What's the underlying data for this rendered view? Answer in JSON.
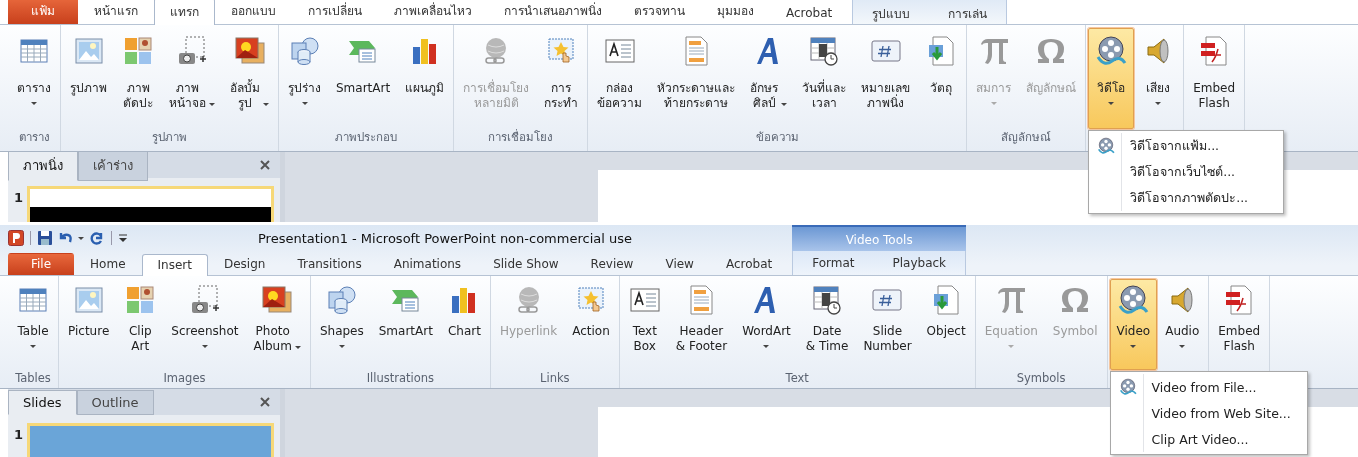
{
  "panels": [
    {
      "tabs": [
        {
          "label": "แฟ้ม",
          "kind": "file",
          "selected": false
        },
        {
          "label": "หน้าแรก",
          "kind": "tab",
          "selected": false
        },
        {
          "label": "แทรก",
          "kind": "tab",
          "selected": true
        },
        {
          "label": "ออกแบบ",
          "kind": "tab",
          "selected": false
        },
        {
          "label": "การเปลี่ยน",
          "kind": "tab",
          "selected": false
        },
        {
          "label": "ภาพเคลื่อนไหว",
          "kind": "tab",
          "selected": false
        },
        {
          "label": "การนำเสนอภาพนิ่ง",
          "kind": "tab",
          "selected": false
        },
        {
          "label": "ตรวจทาน",
          "kind": "tab",
          "selected": false
        },
        {
          "label": "มุมมอง",
          "kind": "tab",
          "selected": false
        },
        {
          "label": "Acrobat",
          "kind": "tab",
          "selected": false
        }
      ],
      "contextual": {
        "tabs": [
          {
            "label": "รูปแบบ",
            "selected": false
          },
          {
            "label": "การเล่น",
            "selected": false
          }
        ]
      },
      "groups": [
        {
          "label": "ตาราง",
          "buttons": [
            {
              "label": "ตาราง",
              "kind": "table",
              "dropdown": true,
              "caret_inline": false,
              "disabled": false,
              "pressed": false
            }
          ]
        },
        {
          "label": "รูปภาพ",
          "buttons": [
            {
              "label": "รูปภาพ",
              "kind": "picture",
              "dropdown": false,
              "disabled": false,
              "pressed": false
            },
            {
              "label": "ภาพ\nตัดปะ",
              "kind": "clipart",
              "dropdown": false,
              "disabled": false,
              "pressed": false
            },
            {
              "label": "ภาพ\nหน้าจอ",
              "kind": "screenshot",
              "dropdown": true,
              "caret_inline": true,
              "disabled": false,
              "pressed": false
            },
            {
              "label": "อัลบั้ม\nรูป",
              "kind": "album",
              "dropdown": true,
              "caret_inline": true,
              "disabled": false,
              "pressed": false
            }
          ]
        },
        {
          "label": "ภาพประกอบ",
          "buttons": [
            {
              "label": "รูปร่าง",
              "kind": "shapes",
              "dropdown": true,
              "caret_inline": false,
              "disabled": false,
              "pressed": false
            },
            {
              "label": "SmartArt",
              "kind": "smartart",
              "dropdown": false,
              "disabled": false,
              "pressed": false
            },
            {
              "label": "แผนภูมิ",
              "kind": "chart",
              "dropdown": false,
              "disabled": false,
              "pressed": false
            }
          ]
        },
        {
          "label": "การเชื่อมโยง",
          "buttons": [
            {
              "label": "การเชื่อมโยง\nหลายมิติ",
              "kind": "hyperlink",
              "dropdown": false,
              "disabled": true,
              "pressed": false
            },
            {
              "label": "การ\nกระทำ",
              "kind": "action",
              "dropdown": false,
              "disabled": false,
              "pressed": false
            }
          ]
        },
        {
          "label": "ข้อความ",
          "buttons": [
            {
              "label": "กล่อง\nข้อความ",
              "kind": "textbox",
              "dropdown": false,
              "disabled": false,
              "pressed": false
            },
            {
              "label": "หัวกระดาษและ\nท้ายกระดาษ",
              "kind": "header",
              "dropdown": false,
              "disabled": false,
              "pressed": false
            },
            {
              "label": "อักษร\nศิลป์",
              "kind": "wordart",
              "dropdown": true,
              "caret_inline": true,
              "disabled": false,
              "pressed": false
            },
            {
              "label": "วันที่และ\nเวลา",
              "kind": "datetime",
              "dropdown": false,
              "disabled": false,
              "pressed": false
            },
            {
              "label": "หมายเลข\nภาพนิ่ง",
              "kind": "slidenumber",
              "dropdown": false,
              "disabled": false,
              "pressed": false
            },
            {
              "label": "วัตถุ",
              "kind": "object",
              "dropdown": false,
              "disabled": false,
              "pressed": false
            }
          ]
        },
        {
          "label": "สัญลักษณ์",
          "buttons": [
            {
              "label": "สมการ",
              "kind": "equation",
              "dropdown": true,
              "caret_inline": false,
              "disabled": true,
              "pressed": false
            },
            {
              "label": "สัญลักษณ์",
              "kind": "symbol",
              "dropdown": false,
              "disabled": true,
              "pressed": false
            }
          ]
        },
        {
          "buttons": [
            {
              "label": "วิดีโอ",
              "kind": "video",
              "dropdown": true,
              "caret_inline": false,
              "disabled": false,
              "pressed": true
            },
            {
              "label": "เสียง",
              "kind": "audio",
              "dropdown": true,
              "caret_inline": false,
              "disabled": false,
              "pressed": false
            }
          ]
        },
        {
          "buttons": [
            {
              "label": "Embed\nFlash",
              "kind": "flash",
              "dropdown": false,
              "disabled": false,
              "pressed": false
            }
          ]
        }
      ],
      "menu": {
        "items": [
          {
            "label": "วิดีโอจากแฟ้ม...",
            "kind": "icon"
          },
          {
            "label": "วิดีโอจากเว็บไซต์...",
            "kind": "plain"
          },
          {
            "label": "วิดีโอจากภาพตัดปะ...",
            "kind": "plain"
          }
        ]
      },
      "pane": {
        "tabs": [
          {
            "label": "ภาพนิ่ง",
            "selected": true
          },
          {
            "label": "เค้าร่าง",
            "selected": false
          }
        ],
        "slide_number": "1",
        "thumbnail": {
          "kind": "blank"
        }
      }
    },
    {
      "title_bar": {
        "title": "Presentation1  -  Microsoft PowerPoint non-commercial use"
      },
      "tabs": [
        {
          "label": "File",
          "kind": "file",
          "selected": false
        },
        {
          "label": "Home",
          "kind": "tab",
          "selected": false
        },
        {
          "label": "Insert",
          "kind": "tab",
          "selected": true
        },
        {
          "label": "Design",
          "kind": "tab",
          "selected": false
        },
        {
          "label": "Transitions",
          "kind": "tab",
          "selected": false
        },
        {
          "label": "Animations",
          "kind": "tab",
          "selected": false
        },
        {
          "label": "Slide Show",
          "kind": "tab",
          "selected": false
        },
        {
          "label": "Review",
          "kind": "tab",
          "selected": false
        },
        {
          "label": "View",
          "kind": "tab",
          "selected": false
        },
        {
          "label": "Acrobat",
          "kind": "tab",
          "selected": false
        }
      ],
      "contextual": {
        "label": "Video Tools",
        "tabs": [
          {
            "label": "Format",
            "selected": false
          },
          {
            "label": "Playback",
            "selected": false
          }
        ]
      },
      "groups": [
        {
          "label": "Tables",
          "buttons": [
            {
              "label": "Table",
              "kind": "table",
              "dropdown": true,
              "caret_inline": false,
              "disabled": false,
              "pressed": false
            }
          ]
        },
        {
          "label": "Images",
          "buttons": [
            {
              "label": "Picture",
              "kind": "picture",
              "dropdown": false,
              "disabled": false,
              "pressed": false
            },
            {
              "label": "Clip\nArt",
              "kind": "clipart",
              "dropdown": false,
              "disabled": false,
              "pressed": false
            },
            {
              "label": "Screenshot",
              "kind": "screenshot",
              "dropdown": true,
              "caret_inline": false,
              "disabled": false,
              "pressed": false
            },
            {
              "label": "Photo\nAlbum",
              "kind": "album",
              "dropdown": true,
              "caret_inline": true,
              "disabled": false,
              "pressed": false
            }
          ]
        },
        {
          "label": "Illustrations",
          "buttons": [
            {
              "label": "Shapes",
              "kind": "shapes",
              "dropdown": true,
              "caret_inline": false,
              "disabled": false,
              "pressed": false
            },
            {
              "label": "SmartArt",
              "kind": "smartart",
              "dropdown": false,
              "disabled": false,
              "pressed": false
            },
            {
              "label": "Chart",
              "kind": "chart",
              "dropdown": false,
              "disabled": false,
              "pressed": false
            }
          ]
        },
        {
          "label": "Links",
          "buttons": [
            {
              "label": "Hyperlink",
              "kind": "hyperlink",
              "dropdown": false,
              "disabled": true,
              "pressed": false
            },
            {
              "label": "Action",
              "kind": "action",
              "dropdown": false,
              "disabled": false,
              "pressed": false
            }
          ]
        },
        {
          "label": "Text",
          "buttons": [
            {
              "label": "Text\nBox",
              "kind": "textbox",
              "dropdown": false,
              "disabled": false,
              "pressed": false
            },
            {
              "label": "Header\n& Footer",
              "kind": "header",
              "dropdown": false,
              "disabled": false,
              "pressed": false
            },
            {
              "label": "WordArt",
              "kind": "wordart",
              "dropdown": true,
              "caret_inline": false,
              "disabled": false,
              "pressed": false
            },
            {
              "label": "Date\n& Time",
              "kind": "datetime",
              "dropdown": false,
              "disabled": false,
              "pressed": false
            },
            {
              "label": "Slide\nNumber",
              "kind": "slidenumber",
              "dropdown": false,
              "disabled": false,
              "pressed": false
            },
            {
              "label": "Object",
              "kind": "object",
              "dropdown": false,
              "disabled": false,
              "pressed": false
            }
          ]
        },
        {
          "label": "Symbols",
          "buttons": [
            {
              "label": "Equation",
              "kind": "equation",
              "dropdown": true,
              "caret_inline": false,
              "disabled": true,
              "pressed": false
            },
            {
              "label": "Symbol",
              "kind": "symbol",
              "dropdown": false,
              "disabled": true,
              "pressed": false
            }
          ]
        },
        {
          "buttons": [
            {
              "label": "Video",
              "kind": "video",
              "dropdown": true,
              "caret_inline": false,
              "disabled": false,
              "pressed": true
            },
            {
              "label": "Audio",
              "kind": "audio",
              "dropdown": true,
              "caret_inline": false,
              "disabled": false,
              "pressed": false
            }
          ]
        },
        {
          "buttons": [
            {
              "label": "Embed\nFlash",
              "kind": "flash",
              "dropdown": false,
              "disabled": false,
              "pressed": false
            }
          ]
        }
      ],
      "menu": {
        "items": [
          {
            "label": "Video from File...",
            "kind": "icon"
          },
          {
            "label": "Video from Web Site...",
            "kind": "plain"
          },
          {
            "label": "Clip Art Video...",
            "kind": "plain"
          }
        ]
      },
      "pane": {
        "tabs": [
          {
            "label": "Slides",
            "selected": true
          },
          {
            "label": "Outline",
            "selected": false
          }
        ],
        "slide_number": "1",
        "thumbnail": {
          "kind": "photo"
        }
      }
    }
  ]
}
